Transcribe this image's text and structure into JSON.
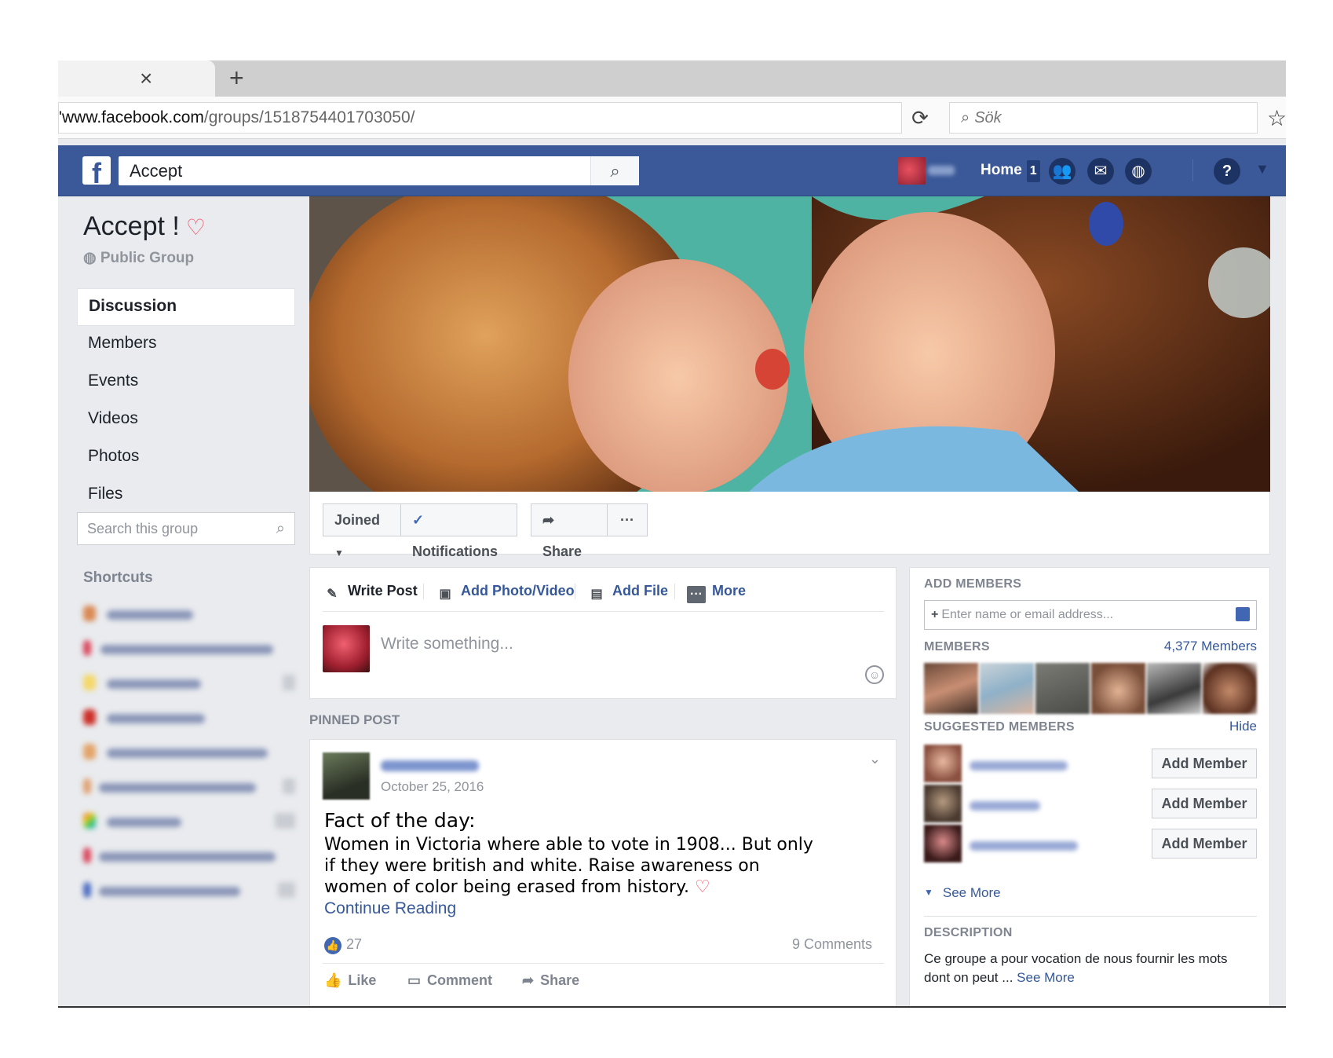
{
  "browser": {
    "url_host": "'www.facebook.com",
    "url_path": "/groups/1518754401703050/",
    "search_placeholder": "Sök"
  },
  "topbar": {
    "search_value": "Accept",
    "home_label": "Home",
    "home_badge": "1"
  },
  "group": {
    "name": "Accept !",
    "type": "Public Group"
  },
  "nav": {
    "items": [
      "Discussion",
      "Members",
      "Events",
      "Videos",
      "Photos",
      "Files"
    ],
    "active": "Discussion",
    "search_placeholder": "Search this group"
  },
  "shortcuts": {
    "title": "Shortcuts"
  },
  "cover_actions": {
    "joined": "Joined",
    "notifications": "Notifications",
    "share": "Share",
    "more": "···"
  },
  "composer": {
    "tabs": [
      "Write Post",
      "Add Photo/Video",
      "Add File",
      "More"
    ],
    "placeholder": "Write something..."
  },
  "pinned": {
    "label": "PINNED POST",
    "date": "October 25, 2016",
    "title": "Fact of the day:",
    "body": "Women in Victoria where able to vote in 1908... But only if they were british and white. Raise awareness on women of color being erased from history.",
    "continue": "Continue Reading",
    "likes": "27",
    "comments": "9 Comments",
    "actions": [
      "Like",
      "Comment",
      "Share"
    ]
  },
  "right": {
    "add_members_title": "ADD MEMBERS",
    "add_placeholder": "Enter name or email address...",
    "members_title": "MEMBERS",
    "members_count": "4,377 Members",
    "suggested_title": "SUGGESTED MEMBERS",
    "hide": "Hide",
    "add_member_label": "Add Member",
    "see_more": "See More",
    "description_title": "DESCRIPTION",
    "description": "Ce groupe a pour vocation de nous fournir les mots dont on peut ...",
    "description_more": "See More"
  },
  "colors": {
    "fb_blue": "#3b5998",
    "link": "#365899",
    "heart": "#f35369"
  }
}
